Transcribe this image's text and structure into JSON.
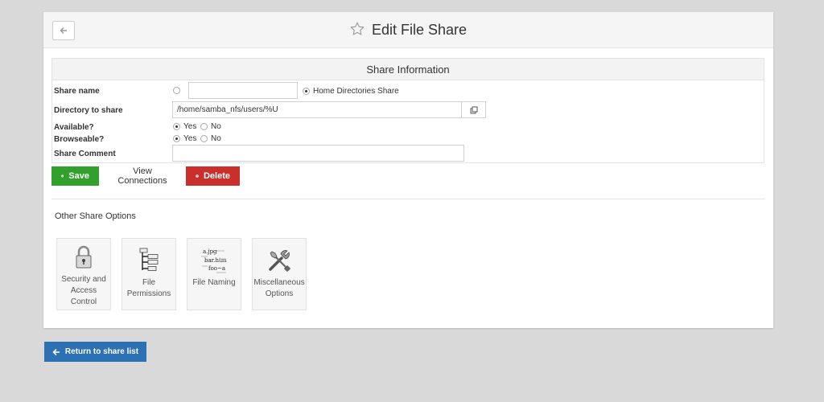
{
  "header": {
    "title": "Edit File Share",
    "back_icon": "arrow-left-icon",
    "star_icon": "star-outline-icon"
  },
  "form": {
    "title": "Share Information",
    "share_name_label": "Share name",
    "share_name_value": "",
    "home_directories_label": "Home Directories Share",
    "directory_label": "Directory to share",
    "directory_value": "/home/samba_nfs/users/%U",
    "available_label": "Available?",
    "browseable_label": "Browseable?",
    "yes_label": "Yes",
    "no_label": "No",
    "comment_label": "Share Comment",
    "comment_value": ""
  },
  "actions": {
    "save_label": "Save",
    "view_connections_label": "View Connections",
    "delete_label": "Delete"
  },
  "other_options": {
    "title": "Other Share Options",
    "tiles": [
      {
        "label": "Security and Access Control",
        "icon": "padlock-icon"
      },
      {
        "label": "File Permissions",
        "icon": "file-tree-icon"
      },
      {
        "label": "File Naming",
        "icon": "file-naming-icon"
      },
      {
        "label": "Miscellaneous Options",
        "icon": "tools-icon"
      }
    ],
    "file_naming_icon_text": [
      "a.jpg",
      "bar.htm",
      "foo~a"
    ]
  },
  "footer": {
    "return_label": "Return to share list"
  },
  "colors": {
    "save": "#31a02c",
    "delete": "#c9302c",
    "return": "#2b71b4"
  }
}
